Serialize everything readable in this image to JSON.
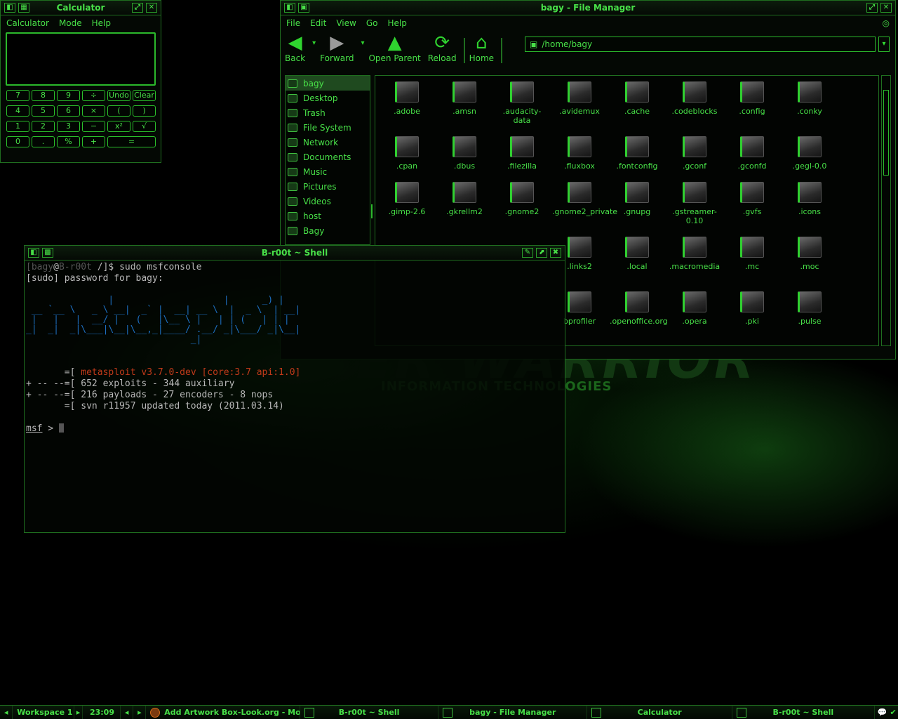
{
  "wallpaper": {
    "line1": "YBER WARRIOR",
    "line2": "INFORMATION TECHNOLOGIES"
  },
  "calculator": {
    "title": "Calculator",
    "menu": [
      "Calculator",
      "Mode",
      "Help"
    ],
    "display": "",
    "buttons": [
      "7",
      "8",
      "9",
      "÷",
      "Undo",
      "Clear",
      "4",
      "5",
      "6",
      "×",
      "(",
      ")",
      "1",
      "2",
      "3",
      "−",
      "x²",
      "√",
      "0",
      ".",
      "%",
      "+",
      "="
    ]
  },
  "filemanager": {
    "title": "bagy - File Manager",
    "menu": [
      "File",
      "Edit",
      "View",
      "Go",
      "Help"
    ],
    "toolbar": {
      "back": "Back",
      "forward": "Forward",
      "open_parent": "Open Parent",
      "reload": "Reload",
      "home": "Home"
    },
    "location": "/home/bagy",
    "sidebar": [
      "bagy",
      "Desktop",
      "Trash",
      "File System",
      "Network",
      "Documents",
      "Music",
      "Pictures",
      "Videos",
      "host",
      "Bagy"
    ],
    "files": [
      ".adobe",
      ".amsn",
      ".audacity-data",
      ".avidemux",
      ".cache",
      ".codeblocks",
      ".config",
      ".conky",
      ".cpan",
      ".dbus",
      ".filezilla",
      ".fluxbox",
      ".fontconfig",
      ".gconf",
      ".gconfd",
      ".gegl-0.0",
      ".gimp-2.6",
      ".gkrellm2",
      ".gnome2",
      ".gnome2_private",
      ".gnupg",
      ".gstreamer-0.10",
      ".gvfs",
      ".icons",
      ".links2",
      ".local",
      ".macromedia",
      ".mc",
      ".moc",
      "bprofiler",
      ".openoffice.org",
      ".opera",
      ".pki",
      ".pulse"
    ]
  },
  "shell": {
    "title": "B-r00t ~ Shell",
    "prompt_user": "bagy",
    "prompt_at": "@",
    "prompt_host": "B-r00t",
    "prompt_path": " /]$ ",
    "command": "sudo msfconsole",
    "password_line": "[sudo] password for bagy:",
    "banner": "               |                    |      _) |\n __ `__ \\   _ \\ __|  _` |  __| __ \\  |  _ \\  | __|\n |   |   |  __/ |   (   |\\__ \\ |   | | (   | | |\n_|  _|  _|\\___|\\__|\\__,_|____/ .__/ _|\\___/ _|\\__|\n                              _|",
    "info_prefix_1": "       =[ ",
    "info_text_1": "metasploit v3.7.0-dev [core:3.7 api:1.0]",
    "info_line_2": "+ -- --=[ 652 exploits - 344 auxiliary",
    "info_line_3": "+ -- --=[ 216 payloads - 27 encoders - 8 nops",
    "info_line_4": "       =[ svn r11957 updated today (2011.03.14)",
    "msf_prompt": "msf",
    "msf_suffix": " > "
  },
  "taskbar": {
    "workspace": "Workspace 1",
    "clock": "23:09",
    "tasks": [
      "Add  Artwork Box-Look.org - Mozil",
      "B-r00t ~ Shell",
      "bagy - File Manager",
      "Calculator",
      "B-r00t ~ Shell"
    ]
  }
}
